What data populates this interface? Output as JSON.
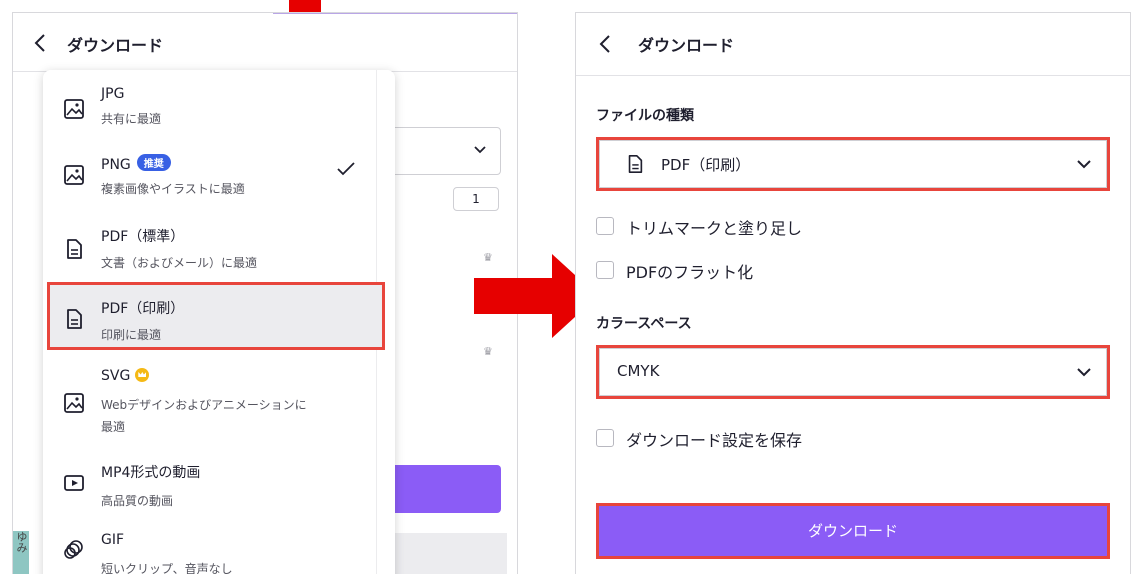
{
  "colors": {
    "accent_purple": "#8b5cf6",
    "highlight_red": "#e8453c",
    "badge_blue": "#3860e4",
    "arrow_red": "#e60000"
  },
  "left_panel": {
    "title": "ダウンロード",
    "quantity": "1",
    "menu": {
      "items": [
        {
          "label": "JPG",
          "sub": "共有に最適",
          "icon": "image-icon"
        },
        {
          "label": "PNG",
          "badge": "推奨",
          "sub": "複素画像やイラストに最適",
          "icon": "image-icon",
          "selected_check": true
        },
        {
          "label": "PDF（標準）",
          "sub": "文書（およびメール）に最適",
          "icon": "document-icon"
        },
        {
          "label": "PDF（印刷）",
          "sub": "印刷に最適",
          "icon": "document-icon",
          "highlighted": true
        },
        {
          "label": "SVG",
          "sub": "Webデザインおよびアニメーションに",
          "sub2": "最適",
          "icon": "image-icon",
          "premium": true
        },
        {
          "label": "MP4形式の動画",
          "sub": "高品質の動画",
          "icon": "video-icon"
        },
        {
          "label": "GIF",
          "sub": "短いクリップ、音声なし",
          "icon": "gif-icon"
        }
      ]
    },
    "side_snippet": "ゆみ"
  },
  "right_panel": {
    "title": "ダウンロード",
    "file_type_label": "ファイルの種類",
    "file_type_value": "PDF（印刷）",
    "options": [
      {
        "label": "トリムマークと塗り足し",
        "checked": false
      },
      {
        "label": "PDFのフラット化",
        "checked": false
      }
    ],
    "color_space_label": "カラースペース",
    "color_space_value": "CMYK",
    "save_settings_label": "ダウンロード設定を保存",
    "save_settings_checked": false,
    "download_button": "ダウンロード"
  }
}
